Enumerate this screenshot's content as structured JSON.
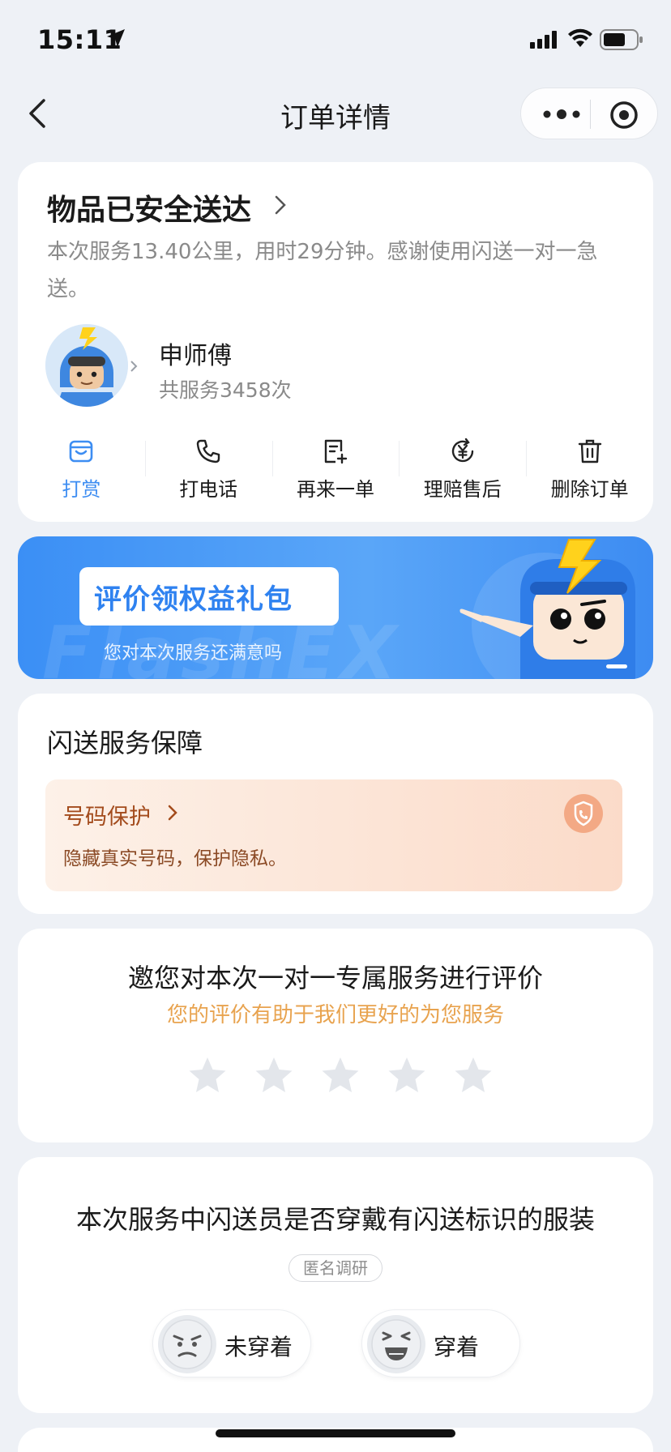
{
  "status_bar": {
    "time": "15:11"
  },
  "nav": {
    "title": "订单详情"
  },
  "order_status": {
    "title": "物品已安全送达",
    "description": "本次服务13.40公里，用时29分钟。感谢使用闪送一对一急送。"
  },
  "courier": {
    "name": "申师傅",
    "service_count": "共服务3458次"
  },
  "actions": [
    {
      "label": "打赏",
      "icon": "tip-box-icon"
    },
    {
      "label": "打电话",
      "icon": "phone-icon"
    },
    {
      "label": "再来一单",
      "icon": "reorder-icon"
    },
    {
      "label": "理赔售后",
      "icon": "yuan-refund-icon"
    },
    {
      "label": "删除订单",
      "icon": "trash-icon"
    }
  ],
  "banner": {
    "title": "评价领权益礼包",
    "subtitle": "您对本次服务还满意吗",
    "watermark": "FlashEX"
  },
  "guarantee": {
    "title": "闪送服务保障",
    "item_title": "号码保护",
    "item_desc": "隐藏真实号码，保护隐私。"
  },
  "rating": {
    "title": "邀您对本次一对一专属服务进行评价",
    "subtitle": "您的评价有助于我们更好的为您服务",
    "star_count": 5,
    "selected_stars": 0
  },
  "survey": {
    "title": "本次服务中闪送员是否穿戴有闪送标识的服装",
    "tag": "匿名调研",
    "options": [
      {
        "label": "未穿着",
        "face": "angry-face-icon"
      },
      {
        "label": "穿着",
        "face": "laughing-face-icon"
      }
    ]
  },
  "colors": {
    "accent": "#3d8df2",
    "banner_blue": "#3b8ff5",
    "guarantee_text": "#a34b1c",
    "rating_subtitle": "#e8a34f",
    "page_bg": "#eef1f6"
  }
}
